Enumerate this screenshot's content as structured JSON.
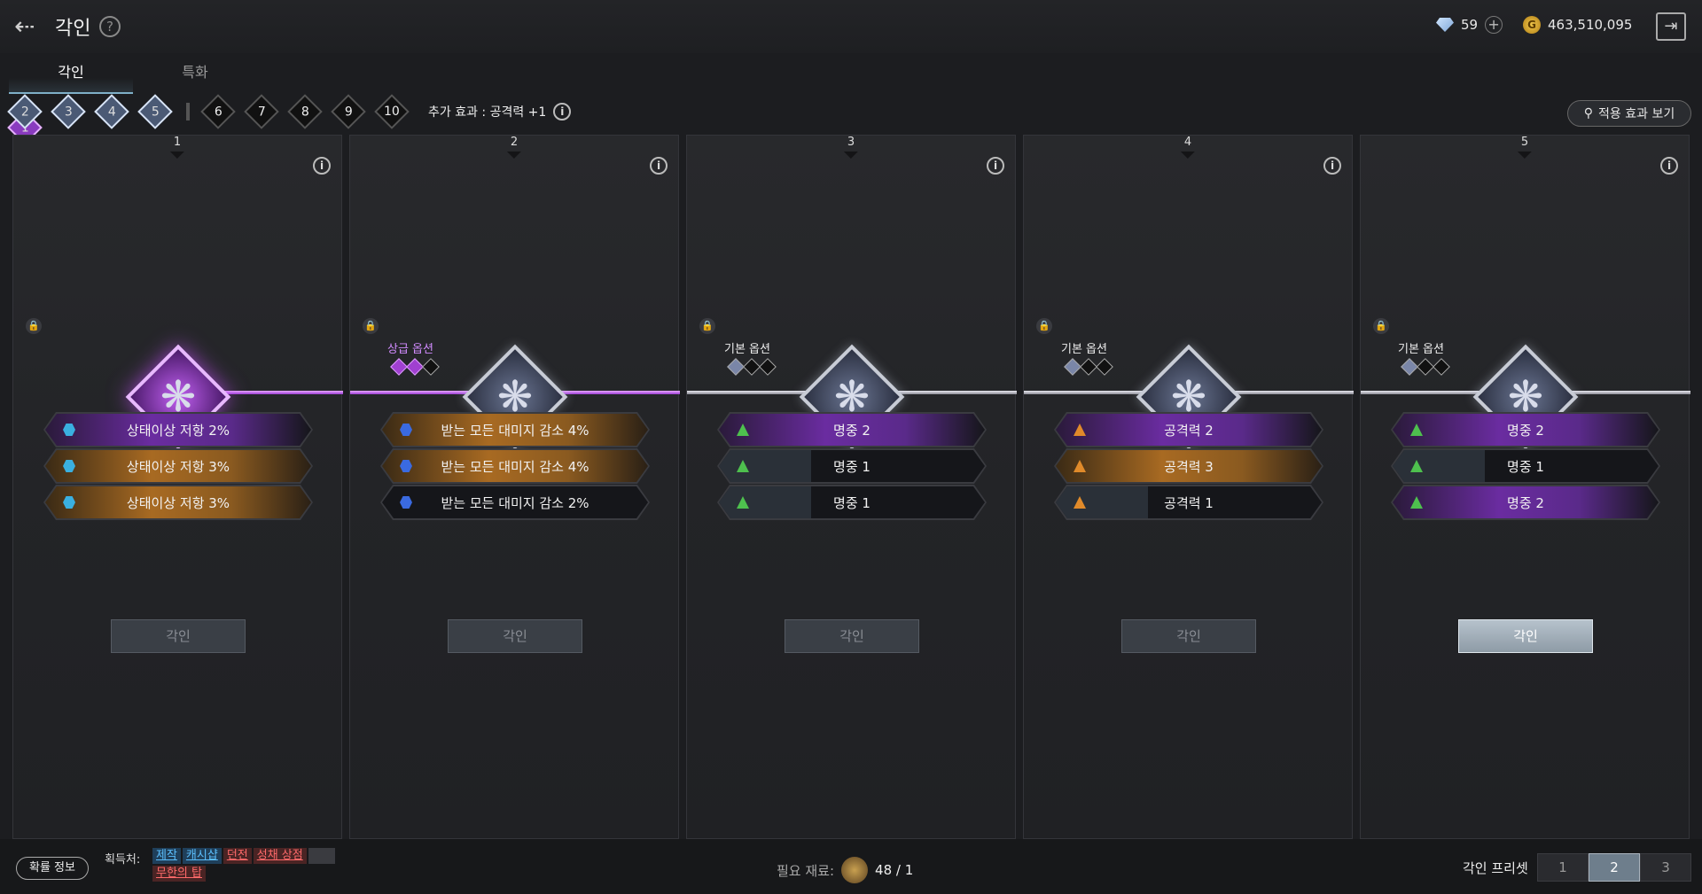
{
  "header": {
    "title": "각인",
    "help": "?",
    "back_icon": "arrow-left-icon",
    "gems": "59",
    "plus": "+",
    "gold": "463,510,095",
    "coin_glyph": "G",
    "exit_icon": "exit-icon"
  },
  "tabs": [
    "각인",
    "특화"
  ],
  "steps": [
    "1",
    "2",
    "3",
    "4",
    "5",
    "6",
    "7",
    "8",
    "9",
    "10"
  ],
  "extra_effect": "추가 효과 : 공격력 +1",
  "info_glyph": "i",
  "effect_button": "적용 효과 보기",
  "panels": [
    {
      "num": "1",
      "label": "",
      "emblem": "purple",
      "options": [
        {
          "text": "상태이상 저항 2%",
          "style": "pur",
          "icon": "hex"
        },
        {
          "text": "상태이상 저항 3%",
          "style": "gold",
          "icon": "hex"
        },
        {
          "text": "상태이상 저항 3%",
          "style": "gold",
          "icon": "hex"
        }
      ],
      "button": "각인",
      "button_active": false
    },
    {
      "num": "2",
      "label": "상급 옵션",
      "emblem": "silver",
      "options": [
        {
          "text": "받는 모든 대미지 감소 4%",
          "style": "gold",
          "icon": "hex-blue"
        },
        {
          "text": "받는 모든 대미지 감소 4%",
          "style": "gold",
          "icon": "hex-blue"
        },
        {
          "text": "받는 모든 대미지 감소 2%",
          "style": "dark",
          "icon": "hex-blue"
        }
      ],
      "button": "각인",
      "button_active": false
    },
    {
      "num": "3",
      "label": "기본 옵션",
      "emblem": "silver",
      "options": [
        {
          "text": "명중 2",
          "style": "pur",
          "icon": "tri"
        },
        {
          "text": "명중 1",
          "style": "bar",
          "icon": "tri"
        },
        {
          "text": "명중 1",
          "style": "bar",
          "icon": "tri"
        }
      ],
      "button": "각인",
      "button_active": false
    },
    {
      "num": "4",
      "label": "기본 옵션",
      "emblem": "silver",
      "options": [
        {
          "text": "공격력 2",
          "style": "pur",
          "icon": "tri-orange"
        },
        {
          "text": "공격력 3",
          "style": "gold",
          "icon": "tri-orange"
        },
        {
          "text": "공격력 1",
          "style": "bar",
          "icon": "tri-orange"
        }
      ],
      "button": "각인",
      "button_active": false
    },
    {
      "num": "5",
      "label": "기본 옵션",
      "emblem": "silver",
      "options": [
        {
          "text": "명중 2",
          "style": "pur",
          "icon": "tri"
        },
        {
          "text": "명중 1",
          "style": "bar",
          "icon": "tri"
        },
        {
          "text": "명중 2",
          "style": "pur",
          "icon": "tri"
        }
      ],
      "button": "각인",
      "button_active": true
    }
  ],
  "bottom": {
    "prob": "확률 정보",
    "source": "획득처:",
    "tags": [
      {
        "t": "제작",
        "c": "blue"
      },
      {
        "t": "캐시샵",
        "c": "blue"
      },
      {
        "t": "던전",
        "c": "red"
      },
      {
        "t": "성채 상점",
        "c": "red"
      },
      {
        "t": "",
        "c": "gray"
      },
      {
        "t": "무한의 탑",
        "c": "red"
      }
    ],
    "need_label": "필요 재료:",
    "need_value": "48 / 1",
    "preset_label": "각인 프리셋",
    "presets": [
      "1",
      "2",
      "3"
    ]
  }
}
